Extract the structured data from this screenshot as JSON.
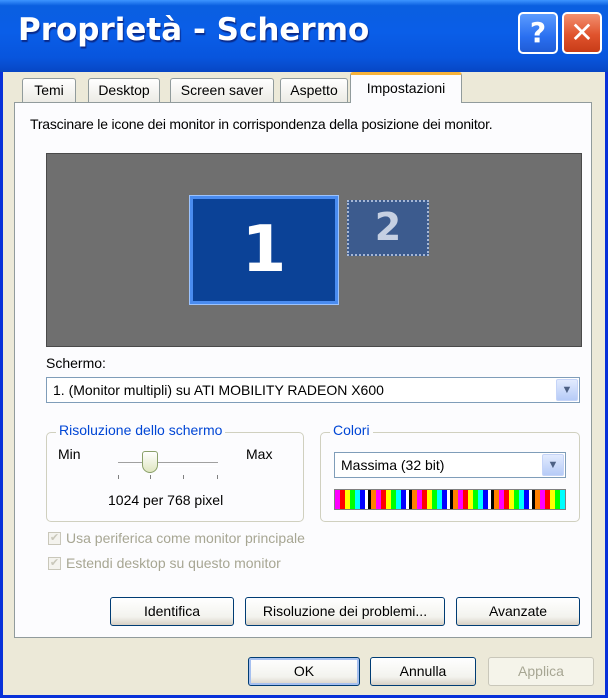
{
  "window": {
    "title": "Proprietà - Schermo",
    "help_glyph": "?",
    "close_glyph": "✕"
  },
  "tabs": [
    {
      "label": "Temi"
    },
    {
      "label": "Desktop"
    },
    {
      "label": "Screen saver"
    },
    {
      "label": "Aspetto"
    },
    {
      "label": "Impostazioni",
      "active": true
    }
  ],
  "settings": {
    "instruction": "Trascinare le icone dei monitor in corrispondenza della posizione dei monitor.",
    "monitors": [
      "1",
      "2"
    ],
    "display_label": "Schermo:",
    "display_value": "1. (Monitor multipli) su ATI MOBILITY RADEON X600",
    "resolution": {
      "label": "Risoluzione dello schermo",
      "min_label": "Min",
      "max_label": "Max",
      "value_text": "1024 per 768 pixel",
      "slider_position": 0.25
    },
    "colors": {
      "label": "Colori",
      "value": "Massima (32 bit)"
    },
    "primary_checkbox": {
      "label": "Usa periferica come monitor principale",
      "checked": true,
      "disabled": true
    },
    "extend_checkbox": {
      "label": "Estendi desktop su questo monitor",
      "checked": true,
      "disabled": true
    },
    "buttons": {
      "identify": "Identifica",
      "troubleshoot": "Risoluzione dei problemi...",
      "advanced": "Avanzate"
    }
  },
  "footer": {
    "ok": "OK",
    "cancel": "Annulla",
    "apply": "Applica"
  },
  "colors_theme": {
    "titlebar": "#0a5ee8",
    "active_tab_accent": "#f7b33b",
    "primary_monitor": "#0b4297",
    "monitor_area": "#6f6f6f"
  },
  "icons": {
    "dropdown": "chevron-down-icon",
    "checkmark": "checkmark-icon"
  }
}
